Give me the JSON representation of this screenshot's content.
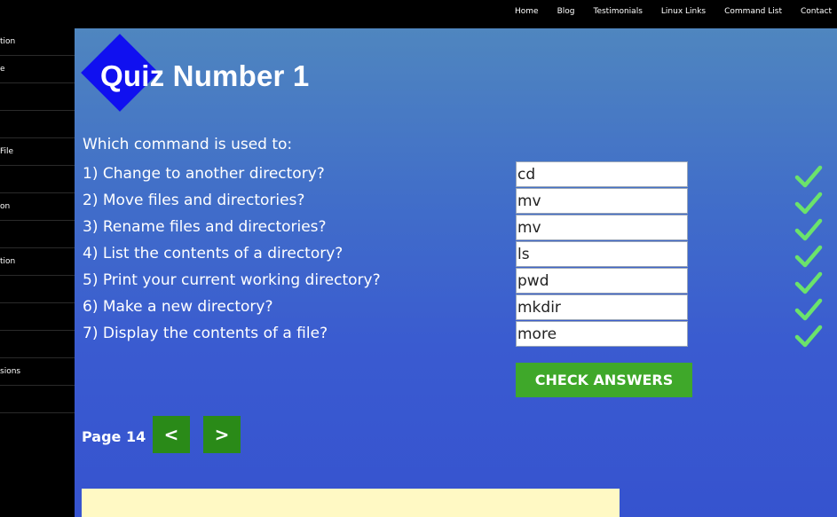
{
  "nav": {
    "items": [
      "Home",
      "Blog",
      "Testimonials",
      "Linux Links",
      "Command List",
      "Contact"
    ]
  },
  "sidebar": {
    "items": [
      "tion",
      "e",
      "",
      "",
      "File",
      "",
      "on",
      "",
      "tion",
      "",
      "",
      "",
      "sions",
      ""
    ]
  },
  "quiz": {
    "title": "Quiz Number 1",
    "intro": "Which command is used to:",
    "questions": [
      {
        "text": "1) Change to another directory?",
        "answer": "cd"
      },
      {
        "text": "2) Move files and directories?",
        "answer": "mv"
      },
      {
        "text": "3) Rename files and directories?",
        "answer": "mv"
      },
      {
        "text": "4) List the contents of a directory?",
        "answer": "ls"
      },
      {
        "text": "5) Print your current working directory?",
        "answer": "pwd"
      },
      {
        "text": "6) Make a new directory?",
        "answer": "mkdir"
      },
      {
        "text": "7) Display the contents of a file?",
        "answer": "more"
      }
    ],
    "check_label": "CHECK ANSWERS"
  },
  "pager": {
    "page_label": "Page 14",
    "prev_label": "<",
    "next_label": ">"
  },
  "colors": {
    "checkmark": "#6be36b",
    "check_button": "#3fa82a",
    "pager_button": "#2a8a18",
    "logo": "#1010f0",
    "note_box": "#fff9c4"
  }
}
